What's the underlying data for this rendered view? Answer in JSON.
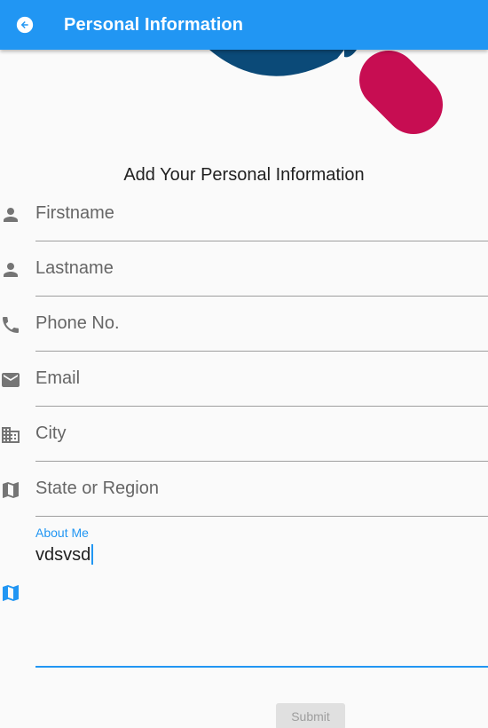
{
  "app_bar": {
    "title": "Personal Information",
    "back_icon": "arrow-back-icon",
    "color": "#2196f3"
  },
  "heading": "Add Your Personal Information",
  "fields": [
    {
      "label": "Firstname",
      "icon": "person-icon"
    },
    {
      "label": "Lastname",
      "icon": "person-icon"
    },
    {
      "label": "Phone No.",
      "icon": "phone-icon"
    },
    {
      "label": "Email",
      "icon": "email-icon"
    },
    {
      "label": "City",
      "icon": "city-icon"
    },
    {
      "label": "State or Region",
      "icon": "map-icon"
    }
  ],
  "about_me": {
    "label": "About Me",
    "value": "vdsvsd",
    "icon": "map-icon",
    "focused_color": "#2196f3"
  },
  "submit": {
    "label": "Submit",
    "enabled": false
  },
  "colors": {
    "accent_blue": "#2196f3",
    "decor_navy": "#0b4a78",
    "decor_pink": "#c70d52"
  }
}
